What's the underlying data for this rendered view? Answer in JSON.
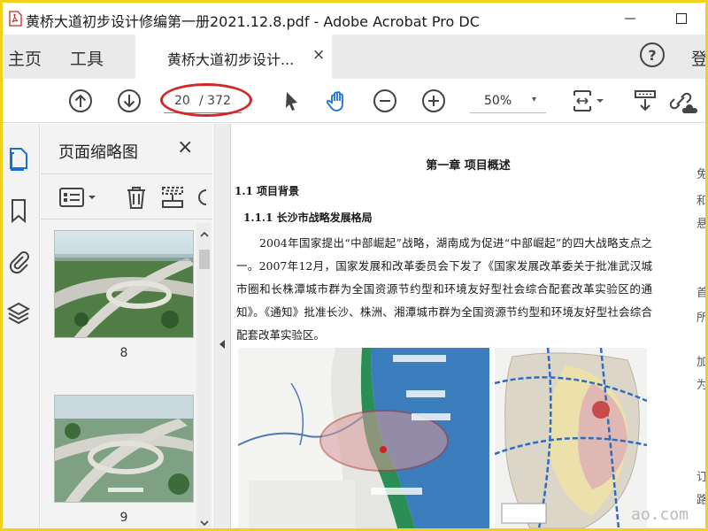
{
  "window": {
    "title": "黄桥大道初步设计修编第一册2021.12.8.pdf - Adobe Acrobat Pro DC",
    "minimize_icon": "minimize-icon",
    "maximize_icon": "maximize-icon"
  },
  "nav": {
    "home_label": "主页",
    "tools_label": "工具",
    "tab_label": "黄桥大道初步设计...",
    "tab_close": "×",
    "help_label": "?",
    "signin_label": "登"
  },
  "toolbar": {
    "page_current": "20",
    "page_total": "/ 372",
    "zoom": "50%",
    "zoom_caret": "▾",
    "icons": [
      "prev-page-icon",
      "next-page-icon",
      "select-cursor-icon",
      "hand-tool-icon",
      "zoom-out-icon",
      "zoom-in-icon",
      "fit-page-icon",
      "scroll-mode-icon",
      "share-link-icon"
    ]
  },
  "rail": {
    "items": [
      "page-thumbnails-icon",
      "bookmarks-icon",
      "attachments-icon",
      "layers-icon"
    ]
  },
  "thumbnails": {
    "title": "页面缩略图",
    "close": "×",
    "pages": [
      {
        "label": "8"
      },
      {
        "label": "9"
      }
    ]
  },
  "document": {
    "chapter_title": "第一章  项目概述",
    "h1": "1.1  项目背景",
    "h2": "1.1.1  长沙市战略发展格局",
    "paragraph": "2004年国家提出“中部崛起”战略，湖南成为促进“中部崛起”的四大战略支点之一。2007年12月，国家发展和改革委员会下发了《国家发展改革委关于批准武汉城市圈和长株潭城市群为全国资源节约型和环境友好型社会综合配套改革实验区的通知》。《通知》批准长沙、株洲、湘潭城市群为全国资源节约型和环境友好型社会综合配套改革实验区。",
    "right_col_chars": [
      "免",
      "和",
      "悬",
      "首",
      "所",
      "加",
      "为",
      "订",
      "路"
    ]
  },
  "watermark": "ao.com"
}
